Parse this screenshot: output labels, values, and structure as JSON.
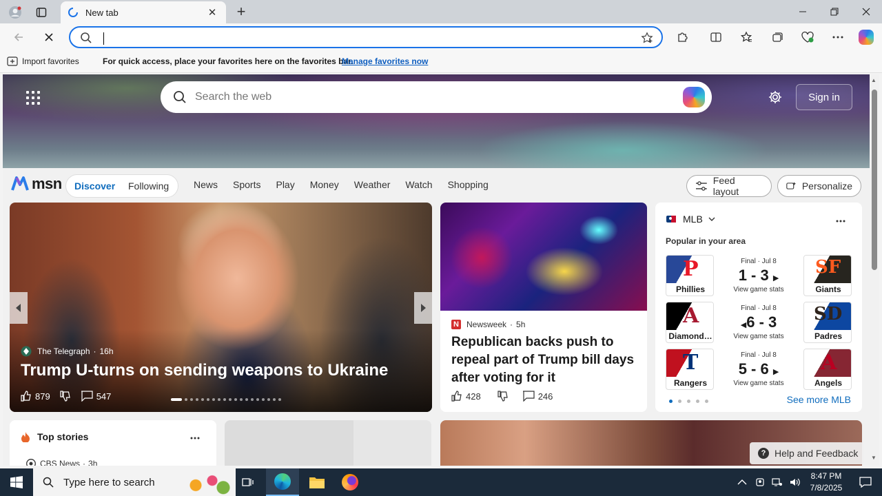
{
  "browser": {
    "tab": {
      "title": "New tab",
      "close": "✕"
    },
    "new_tab": "+",
    "favorites_bar": {
      "import_label": "Import favorites",
      "message": "For quick access, place your favorites here on the favorites bar.",
      "manage_link": "Manage favorites now"
    }
  },
  "msn": {
    "search_placeholder": "Search the web",
    "sign_in": "Sign in",
    "logo_text": "msn",
    "discover": "Discover",
    "following": "Following",
    "nav": [
      "News",
      "Sports",
      "Play",
      "Money",
      "Weather",
      "Watch",
      "Shopping"
    ],
    "feed_layout": "Feed layout",
    "personalize": "Personalize"
  },
  "featured_story": {
    "source": "The Telegraph",
    "age": "16h",
    "headline": "Trump U-turns on sending weapons to Ukraine",
    "likes": "879",
    "comments": "547"
  },
  "news_story": {
    "source_logo": "N",
    "source": "Newsweek",
    "age": "5h",
    "headline": "Republican backs push to repeal part of Trump bill days after voting for it",
    "likes": "428",
    "comments": "246"
  },
  "mlb": {
    "title": "MLB",
    "popular": "Popular in your area",
    "see_more": "See more MLB",
    "games": [
      {
        "status": "Final · Jul 8",
        "score": "1 - 3",
        "stats": "View game stats",
        "home": {
          "name": "Phillies",
          "symbol": "P",
          "color": "#e81828",
          "bg": "#284898"
        },
        "away": {
          "name": "Giants",
          "symbol": "SF",
          "color": "#fd5a1e",
          "bg": "#27251f"
        }
      },
      {
        "status": "Final · Jul 8",
        "score": "6 - 3",
        "stats": "View game stats",
        "home": {
          "name": "Diamond…",
          "symbol": "A",
          "color": "#a71930",
          "bg": "#000000"
        },
        "away": {
          "name": "Padres",
          "symbol": "SD",
          "color": "#2f241d",
          "bg": "#0d47a1"
        }
      },
      {
        "status": "Final · Jul 8",
        "score": "5 - 6",
        "stats": "View game stats",
        "home": {
          "name": "Rangers",
          "symbol": "T",
          "color": "#c0111f",
          "bg": "#003278"
        },
        "away": {
          "name": "Angels",
          "symbol": "A",
          "color": "#ba0021",
          "bg": "#862633"
        }
      }
    ]
  },
  "top_stories": {
    "title": "Top stories",
    "source": "CBS News",
    "age": "3h"
  },
  "help": "Help and Feedback",
  "taskbar": {
    "search_placeholder": "Type here to search",
    "time": "8:47 PM",
    "date": "7/8/2025"
  }
}
